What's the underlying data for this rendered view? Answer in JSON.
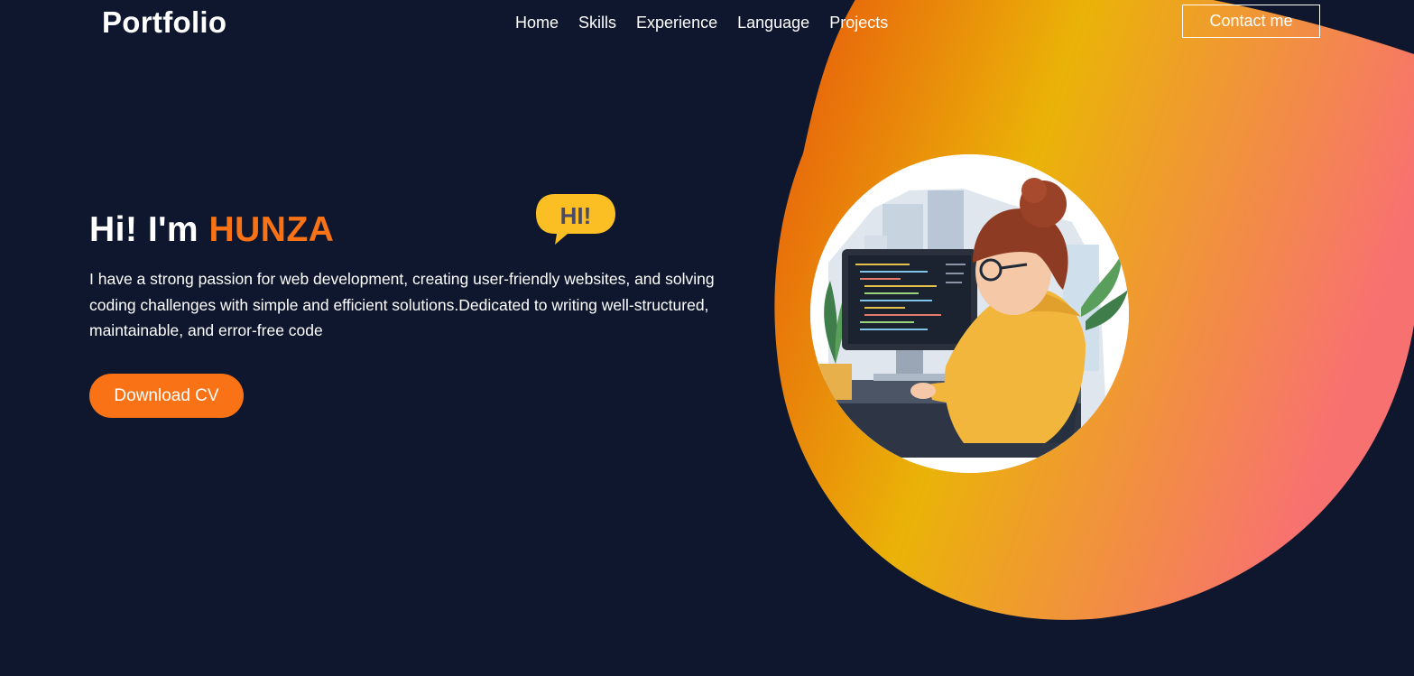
{
  "header": {
    "logo": "Portfolio",
    "nav": [
      "Home",
      "Skills",
      "Experience",
      "Language",
      "Projects"
    ],
    "contact_label": "Contact me"
  },
  "hero": {
    "greeting": "Hi! I'm",
    "name": "HUNZA",
    "description": "I have a strong passion for web development, creating user-friendly websites, and solving coding challenges with simple and efficient solutions.Dedicated to writing well-structured, maintainable, and error-free code",
    "cv_label": "Download CV",
    "bubble_text": "HI!"
  },
  "colors": {
    "background": "#0e172d",
    "accent": "#f97316",
    "blob_gradient": [
      "#e85d0c",
      "#eab308",
      "#f87171"
    ]
  },
  "icons": {
    "hi_bubble": "speech-bubble-icon",
    "portrait": "developer-illustration"
  }
}
